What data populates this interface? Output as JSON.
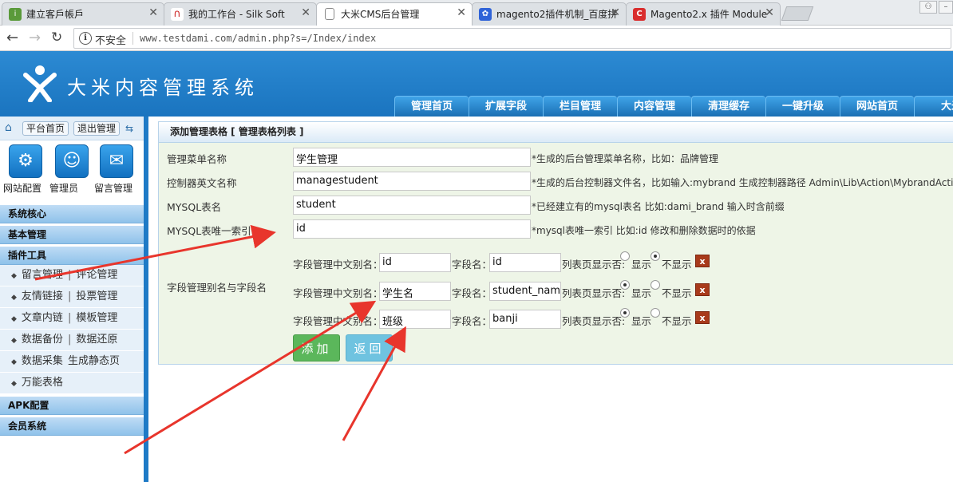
{
  "browser": {
    "tabs": [
      {
        "label": "建立客戶帳戶",
        "icon": "ipage-favicon"
      },
      {
        "label": "我的工作台 - Silk Soft",
        "icon": "silk-favicon"
      },
      {
        "label": "大米CMS后台管理",
        "icon": "page-icon"
      },
      {
        "label": "magento2插件机制_百度拼",
        "icon": "baidu-favicon"
      },
      {
        "label": "Magento2.x 插件 Module",
        "icon": "csdn-favicon"
      }
    ],
    "address": {
      "security": "不安全",
      "url": "www.testdami.com/admin.php?s=/Index/index"
    }
  },
  "header": {
    "title": "大米内容管理系统",
    "nav": [
      "管理首页",
      "扩展字段",
      "栏目管理",
      "内容管理",
      "清理缓存",
      "一键升级",
      "网站首页",
      "大米"
    ]
  },
  "sidebar": {
    "top_buttons": [
      "平台首页",
      "退出管理"
    ],
    "shortcuts": [
      {
        "label": "网站配置",
        "icon": "gear-icon"
      },
      {
        "label": "管理员",
        "icon": "admin-icon"
      },
      {
        "label": "留言管理",
        "icon": "message-icon"
      }
    ],
    "sections": [
      {
        "title": "系统核心"
      },
      {
        "title": "基本管理"
      },
      {
        "title": "插件工具"
      },
      {
        "title": "APK配置"
      },
      {
        "title": "会员系统"
      }
    ],
    "plugin_items": [
      [
        "留言管理",
        "评论管理"
      ],
      [
        "友情链接",
        "投票管理"
      ],
      [
        "文章内链",
        "模板管理"
      ],
      [
        "数据备份",
        "数据还原"
      ],
      [
        "数据采集",
        "生成静态页"
      ],
      [
        "万能表格"
      ]
    ]
  },
  "panel": {
    "title": "添加管理表格 [ 管理表格列表 ]",
    "fields": [
      {
        "label": "管理菜单名称",
        "value": "学生管理",
        "hint": "*生成的后台管理菜单名称，比如：品牌管理"
      },
      {
        "label": "控制器英文名称",
        "value": "managestudent",
        "hint": "*生成的后台控制器文件名，比如输入:mybrand 生成控制器路径 Admin\\Lib\\Action\\MybrandAction.cla"
      },
      {
        "label": "MYSQL表名",
        "value": "student",
        "hint": "*已经建立有的mysql表名 比如:dami_brand 输入时含前缀"
      },
      {
        "label": "MYSQL表唯一索引",
        "value": "id",
        "hint": "*mysql表唯一索引 比如:id 修改和删除数据时的依据"
      }
    ],
    "alias_label": "字段管理别名与字段名",
    "row_labels": {
      "alias": "字段管理中文别名：",
      "field": "字段名：",
      "show": "列表页显示否:",
      "yes": "显示",
      "no": "不显示",
      "delete": "x"
    },
    "rows": [
      {
        "alias": "id",
        "field": "id",
        "show": false
      },
      {
        "alias": "学生名",
        "field": "student_name",
        "show": true
      },
      {
        "alias": "班级",
        "field": "banji",
        "show": true
      }
    ],
    "buttons": {
      "add": "添加",
      "back": "返回"
    }
  }
}
